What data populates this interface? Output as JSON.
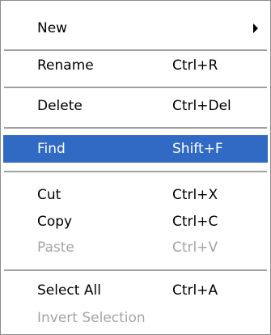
{
  "context_menu": {
    "items": [
      {
        "label": "New",
        "shortcut": "",
        "submenu_icon": "chevron-right-icon",
        "enabled": true
      },
      {
        "label": "Rename",
        "shortcut": "Ctrl+R",
        "enabled": true
      },
      {
        "label": "Delete",
        "shortcut": "Ctrl+Del",
        "enabled": true
      },
      {
        "label": "Find",
        "shortcut": "Shift+F",
        "enabled": true,
        "highlighted": true
      },
      {
        "label": "Cut",
        "shortcut": "Ctrl+X",
        "enabled": true
      },
      {
        "label": "Copy",
        "shortcut": "Ctrl+C",
        "enabled": true
      },
      {
        "label": "Paste",
        "shortcut": "Ctrl+V",
        "enabled": false
      },
      {
        "label": "Select All",
        "shortcut": "Ctrl+A",
        "enabled": true
      },
      {
        "label": "Invert Selection",
        "shortcut": "",
        "enabled": false
      }
    ],
    "highlight_color": "#316ac5",
    "disabled_color": "#a4a4a4"
  }
}
